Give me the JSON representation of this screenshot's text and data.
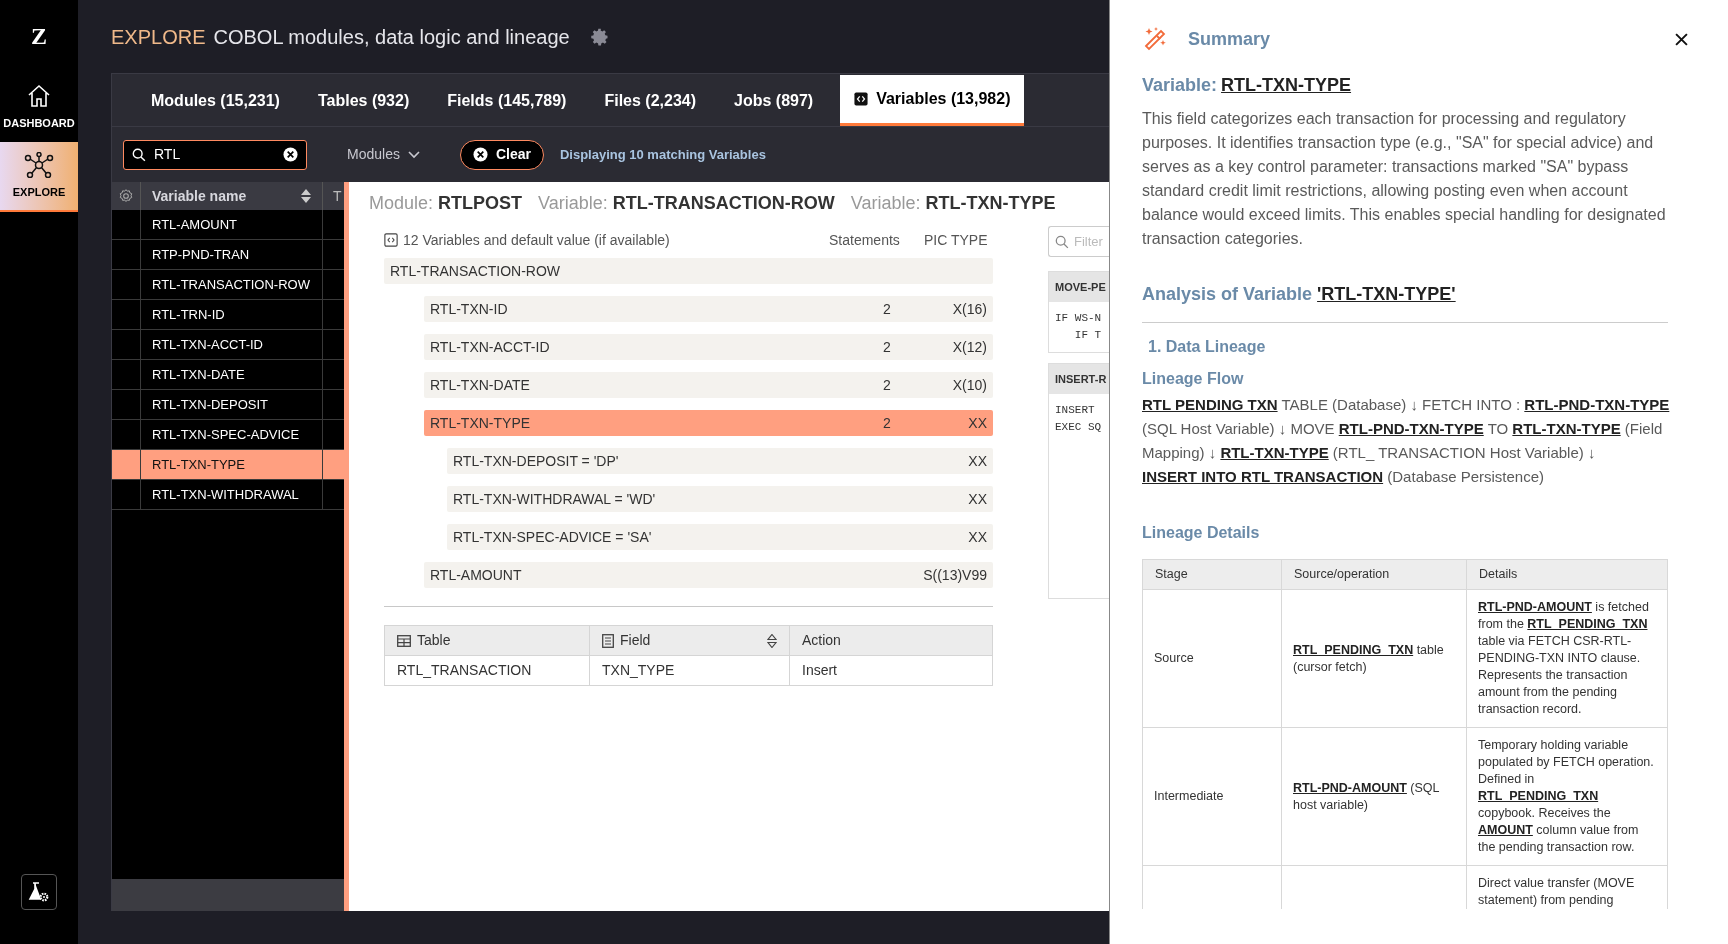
{
  "nav": {
    "logo": "Z",
    "items": [
      {
        "label": "DASHBOARD",
        "selected": false
      },
      {
        "label": "EXPLORE",
        "selected": true
      }
    ]
  },
  "header": {
    "prefix": "EXPLORE",
    "title": "COBOL modules, data logic and lineage"
  },
  "tabs": [
    {
      "label": "Modules (15,231)",
      "selected": false
    },
    {
      "label": "Tables (932)",
      "selected": false
    },
    {
      "label": "Fields (145,789)",
      "selected": false
    },
    {
      "label": "Files (2,234)",
      "selected": false
    },
    {
      "label": "Jobs (897)",
      "selected": false
    },
    {
      "label": "Variables (13,982)",
      "selected": true
    }
  ],
  "filter": {
    "search_value": "RTL",
    "dropdown": "Modules",
    "clear_button": "Clear",
    "result_text": "Displaying 10 matching Variables"
  },
  "variable_list": {
    "columns": [
      "Variable name",
      "T"
    ],
    "rows": [
      {
        "name": "RTL-AMOUNT",
        "selected": false
      },
      {
        "name": "RTP-PND-TRAN",
        "selected": false
      },
      {
        "name": "RTL-TRANSACTION-ROW",
        "selected": false
      },
      {
        "name": "RTL-TRN-ID",
        "selected": false
      },
      {
        "name": "RTL-TXN-ACCT-ID",
        "selected": false
      },
      {
        "name": "RTL-TXN-DATE",
        "selected": false
      },
      {
        "name": "RTL-TXN-DEPOSIT",
        "selected": false
      },
      {
        "name": "RTL-TXN-SPEC-ADVICE",
        "selected": false
      },
      {
        "name": "RTL-TXN-TYPE",
        "selected": true
      },
      {
        "name": "RTL-TXN-WITHDRAWAL",
        "selected": false
      }
    ]
  },
  "breadcrumb": [
    {
      "label": "Module:",
      "value": "RTLPOST"
    },
    {
      "label": "Variable:",
      "value": "RTL-TRANSACTION-ROW"
    },
    {
      "label": "Variable:",
      "value": "RTL-TXN-TYPE"
    }
  ],
  "variables": {
    "title": "12 Variables and default value (if available)",
    "columns": [
      "Statements",
      "PIC TYPE"
    ],
    "rows": [
      {
        "name": "RTL-TRANSACTION-ROW",
        "selected": false,
        "children": [
          {
            "name": "RTL-TXN-ID",
            "statements": "2",
            "pic": "X(16)",
            "selected": false
          },
          {
            "name": "RTL-TXN-ACCT-ID",
            "statements": "2",
            "pic": "X(12)",
            "selected": false
          },
          {
            "name": "RTL-TXN-DATE",
            "statements": "2",
            "pic": "X(10)",
            "selected": false
          },
          {
            "name": "RTL-TXN-TYPE",
            "statements": "2",
            "pic": "XX",
            "selected": true,
            "children": [
              {
                "name": "RTL-TXN-DEPOSIT = 'DP'",
                "pic": "XX",
                "selected": false
              },
              {
                "name": "RTL-TXN-WITHDRAWAL = 'WD'",
                "pic": "XX",
                "selected": false
              },
              {
                "name": "RTL-TXN-SPEC-ADVICE = 'SA'",
                "pic": "XX",
                "selected": false
              }
            ]
          },
          {
            "name": "RTL-AMOUNT",
            "pic": "S((13)V99",
            "selected": false
          }
        ]
      }
    ]
  },
  "usage_table": {
    "columns": [
      {
        "label": "Table",
        "sortable": false
      },
      {
        "label": "Field",
        "sortable": true
      },
      {
        "label": "Action",
        "sortable": false
      }
    ],
    "rows": [
      [
        "RTL_TRANSACTION",
        "TXN_TYPE",
        "Insert"
      ]
    ]
  },
  "filter_field": {
    "placeholder": "Filter"
  },
  "code_cards": [
    {
      "title": "MOVE-PE",
      "lines": [
        "IF WS-N",
        "   IF T"
      ]
    },
    {
      "title": "INSERT-R",
      "lines": [
        "INSERT",
        "EXEC SQ"
      ]
    }
  ],
  "summary": {
    "title": "Summary",
    "variable_label": "Variable:",
    "variable_name": "RTL-TXN-TYPE",
    "description": "This field categorizes each transaction for processing and regulatory purposes. It identifies transaction type (e.g., \"SA\" for special advice) and serves as a key control parameter: transactions marked \"SA\" bypass standard credit limit restrictions, allowing posting even when account balance would exceed limits. This enables special handling for designated transaction categories.",
    "analysis_label": "Analysis of Variable",
    "analysis_name": "'RTL-TXN-TYPE'",
    "section": "1. Data Lineage",
    "flow_title": "Lineage Flow",
    "flow": "**RTL PENDING TXN** TABLE (Database) ↓ FETCH INTO : **RTL-PND-TXN-TYPE** (SQL Host Variable) ↓ MOVE **RTL-PND-TXN-TYPE** TO **RTL-TXN-TYPE** (Field Mapping) ↓ **RTL-TXN-TYPE** (RTL_ TRANSACTION Host Variable) ↓ **INSERT INTO RTL TRANSACTION** (Database Persistence)",
    "details_title": "Lineage Details",
    "details_table": {
      "columns": [
        "Stage",
        "Source/operation",
        "Details"
      ],
      "rows": [
        {
          "stage": "Source",
          "source": "**RTL_PENDING_TXN** table (cursor fetch)",
          "details": "**RTL-PND-AMOUNT** is fetched from the **RTL_PENDING_TXN** table via FETCH CSR-RTL-PENDING-TXN INTO clause. Represents the transaction amount from the pending transaction record."
        },
        {
          "stage": "Intermediate",
          "source": "**RTL-PND-AMOUNT** (SQL host variable)",
          "details": "Temporary holding variable populated by FETCH operation. Defined in **RTL_PENDING_TXN** copybook. Receives the **AMOUNT** column value from the pending transaction row."
        },
        {
          "details": "Direct value transfer (MOVE statement) from pending"
        }
      ]
    }
  }
}
